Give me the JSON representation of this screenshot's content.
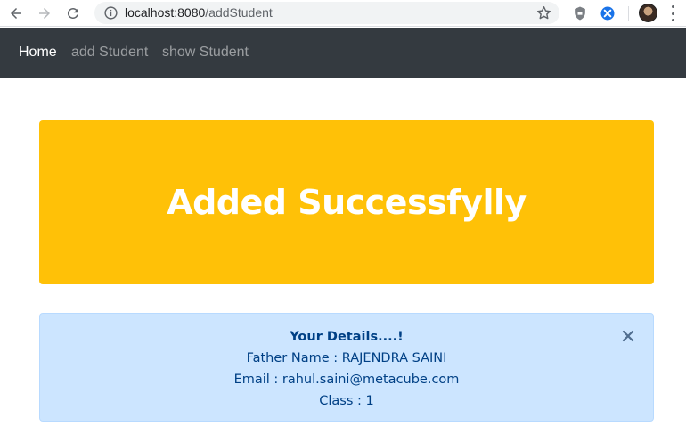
{
  "browser": {
    "url_host": "localhost:8080",
    "url_path": "/addStudent"
  },
  "navbar": {
    "items": [
      {
        "label": "Home",
        "active": true
      },
      {
        "label": "add Student",
        "active": false
      },
      {
        "label": "show Student",
        "active": false
      }
    ]
  },
  "jumbotron": {
    "title": "Added Successfylly",
    "color": "#ffc107"
  },
  "alert": {
    "heading": "Your Details....!",
    "father_name": "Father Name : RAJENDRA SAINI",
    "email": "Email : rahul.saini@metacube.com",
    "class_line": "Class : 1",
    "color": "#cce5ff"
  }
}
